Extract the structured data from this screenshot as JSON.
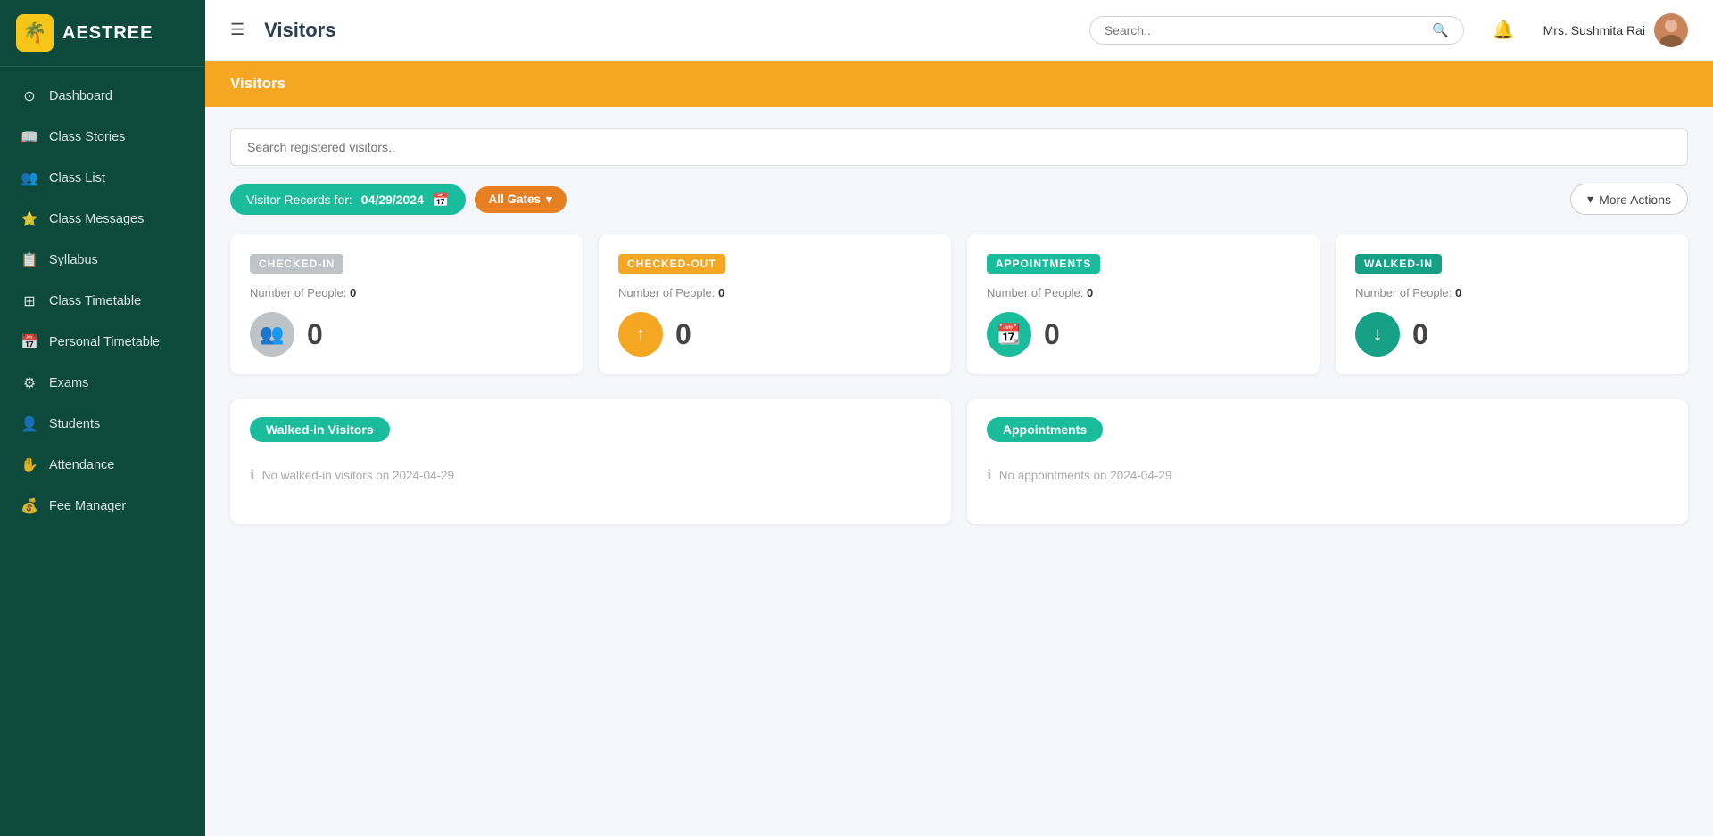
{
  "app": {
    "name": "AESTREE",
    "logo_emoji": "🌴"
  },
  "header": {
    "menu_icon": "☰",
    "title": "Visitors",
    "search_placeholder": "Search..",
    "username": "Mrs. Sushmita Rai",
    "avatar_emoji": "👩"
  },
  "page_banner": {
    "title": "Visitors"
  },
  "sidebar": {
    "items": [
      {
        "label": "Dashboard",
        "icon": "⊙",
        "active": false
      },
      {
        "label": "Class Stories",
        "icon": "📖",
        "active": false
      },
      {
        "label": "Class List",
        "icon": "👥",
        "active": false
      },
      {
        "label": "Class Messages",
        "icon": "⭐",
        "active": false
      },
      {
        "label": "Syllabus",
        "icon": "📋",
        "active": false
      },
      {
        "label": "Class Timetable",
        "icon": "⊞",
        "active": false
      },
      {
        "label": "Personal Timetable",
        "icon": "📅",
        "active": false
      },
      {
        "label": "Exams",
        "icon": "⚙",
        "active": false
      },
      {
        "label": "Students",
        "icon": "👤",
        "active": false
      },
      {
        "label": "Attendance",
        "icon": "✋",
        "active": false
      },
      {
        "label": "Fee Manager",
        "icon": "💰",
        "active": false
      }
    ]
  },
  "visitor_search": {
    "placeholder": "Search registered visitors.."
  },
  "filter": {
    "records_for_label": "Visitor Records for:",
    "date": "04/29/2024",
    "calendar_icon": "📅",
    "gate_label": "All Gates",
    "chevron_icon": "▾",
    "more_actions_label": "More Actions",
    "chevron_more": "▾"
  },
  "stats": [
    {
      "badge_label": "CHECKED-IN",
      "badge_class": "badge-gray",
      "icon_class": "ic-gray",
      "icon": "👥",
      "count_label": "Number of People:",
      "count": "0",
      "number": "0"
    },
    {
      "badge_label": "CHECKED-OUT",
      "badge_class": "badge-orange",
      "icon_class": "ic-orange",
      "icon": "↑",
      "count_label": "Number of People:",
      "count": "0",
      "number": "0"
    },
    {
      "badge_label": "APPOINTMENTS",
      "badge_class": "badge-teal",
      "icon_class": "ic-teal",
      "icon": "📆",
      "count_label": "Number of People:",
      "count": "0",
      "number": "0"
    },
    {
      "badge_label": "WALKED-IN",
      "badge_class": "badge-teal2",
      "icon_class": "ic-teal2",
      "icon": "↓",
      "count_label": "Number of People:",
      "count": "0",
      "number": "0"
    }
  ],
  "sections": [
    {
      "tag": "Walked-in Visitors",
      "empty_message": "No walked-in visitors on 2024-04-29"
    },
    {
      "tag": "Appointments",
      "empty_message": "No appointments on 2024-04-29"
    }
  ]
}
